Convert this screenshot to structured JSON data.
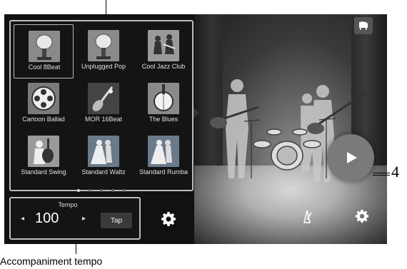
{
  "styles": [
    {
      "label": "Cool 8Beat",
      "icon": "microphone-icon",
      "selected": true
    },
    {
      "label": "Unplugged Pop",
      "icon": "microphone-icon",
      "selected": false
    },
    {
      "label": "Cool Jazz Club",
      "icon": "jazz-band-icon",
      "selected": false
    },
    {
      "label": "Cartoon Ballad",
      "icon": "film-reel-icon",
      "selected": false
    },
    {
      "label": "MOR 16Beat",
      "icon": "electric-guitar-icon",
      "selected": false
    },
    {
      "label": "The Blues",
      "icon": "banjo-icon",
      "selected": false
    },
    {
      "label": "Standard Swing",
      "icon": "acoustic-guitar-icon",
      "selected": false
    },
    {
      "label": "Standard Waltz",
      "icon": "dancers-icon",
      "selected": false
    },
    {
      "label": "Standard Rumba",
      "icon": "dancers-icon",
      "selected": false
    }
  ],
  "page_dots": {
    "count": 5,
    "active": 0
  },
  "tempo": {
    "label": "Tempo",
    "value": "100",
    "decrease": "◂",
    "increase": "▸",
    "tap_label": "Tap"
  },
  "callouts": {
    "number": "4",
    "bottom": "Accompaniment tempo"
  },
  "colors": {
    "panel_border": "#bdbdbd",
    "screen_bg": "#111111",
    "play_button": "#7a7a7a"
  }
}
